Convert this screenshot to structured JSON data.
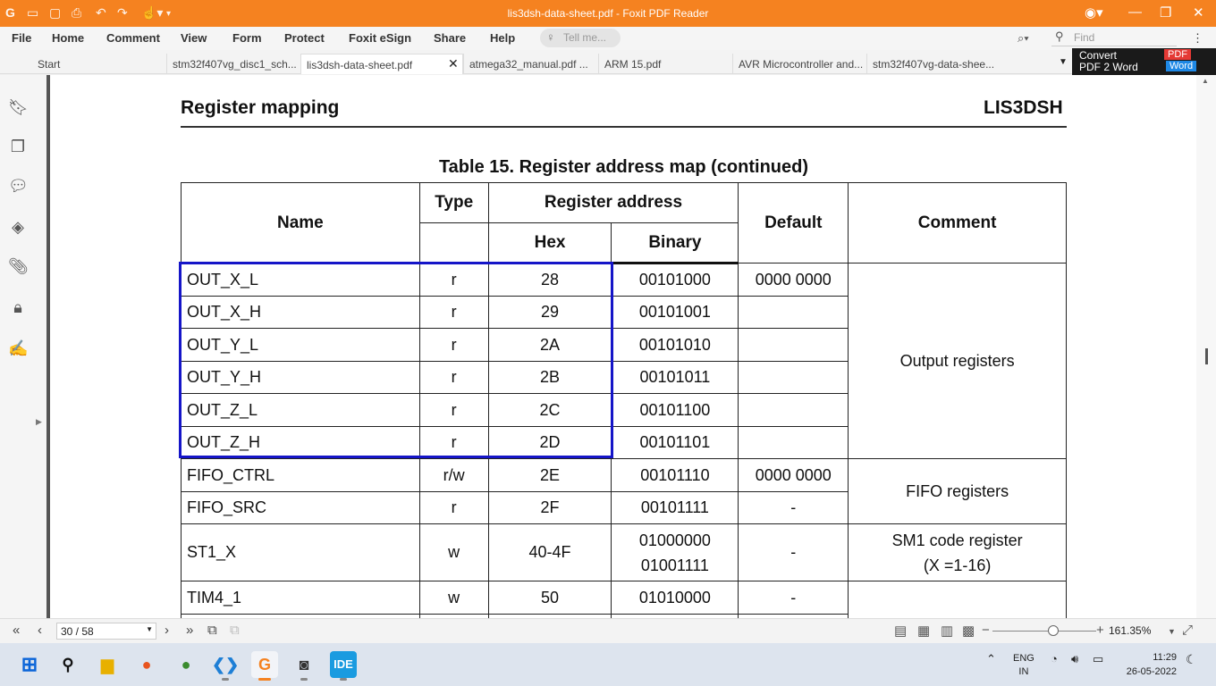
{
  "window": {
    "title": "lis3dsh-data-sheet.pdf - Foxit PDF Reader"
  },
  "menu": {
    "items": [
      "File",
      "Home",
      "Comment",
      "View",
      "Form",
      "Protect",
      "Foxit eSign",
      "Share",
      "Help"
    ],
    "tell_me": "Tell me...",
    "find": "Find"
  },
  "tabs": [
    {
      "label": "Start"
    },
    {
      "label": "stm32f407vg_disc1_sch..."
    },
    {
      "label": "lis3dsh-data-sheet.pdf"
    },
    {
      "label": "atmega32_manual.pdf ..."
    },
    {
      "label": "ARM 15.pdf"
    },
    {
      "label": "AVR Microcontroller and..."
    },
    {
      "label": "stm32f407vg-data-shee..."
    }
  ],
  "ad": {
    "line1": "Convert",
    "line2": "PDF 2 Word",
    "badge_pdf": "PDF",
    "badge_word": "Word"
  },
  "document": {
    "section_title": "Register mapping",
    "part_number": "LIS3DSH",
    "table_caption": "Table 15. Register address map  (continued)",
    "headers": {
      "name": "Name",
      "type": "Type",
      "reg_addr": "Register address",
      "hex": "Hex",
      "binary": "Binary",
      "default": "Default",
      "comment": "Comment"
    },
    "rows": [
      {
        "name": "OUT_X_L",
        "type": "r",
        "hex": "28",
        "binary": "00101000",
        "default": "0000 0000"
      },
      {
        "name": "OUT_X_H",
        "type": "r",
        "hex": "29",
        "binary": "00101001",
        "default": ""
      },
      {
        "name": "OUT_Y_L",
        "type": "r",
        "hex": "2A",
        "binary": "00101010",
        "default": ""
      },
      {
        "name": "OUT_Y_H",
        "type": "r",
        "hex": "2B",
        "binary": "00101011",
        "default": ""
      },
      {
        "name": "OUT_Z_L",
        "type": "r",
        "hex": "2C",
        "binary": "00101100",
        "default": ""
      },
      {
        "name": "OUT_Z_H",
        "type": "r",
        "hex": "2D",
        "binary": "00101101",
        "default": ""
      },
      {
        "name": "FIFO_CTRL",
        "type": "r/w",
        "hex": "2E",
        "binary": "00101110",
        "default": "0000 0000"
      },
      {
        "name": "FIFO_SRC",
        "type": "r",
        "hex": "2F",
        "binary": "00101111",
        "default": "-"
      },
      {
        "name": "ST1_X",
        "type": "w",
        "hex": "40-4F",
        "binary_1": "01000000",
        "binary_2": "01001111",
        "default": "-"
      },
      {
        "name": "TIM4_1",
        "type": "w",
        "hex": "50",
        "binary": "01010000",
        "default": "-"
      }
    ],
    "comments": {
      "output": "Output registers",
      "fifo": "FIFO registers",
      "sm1_1": "SM1 code register",
      "sm1_2": "(X =1-16)"
    }
  },
  "status": {
    "page": "30 / 58",
    "zoom": "161.35%"
  },
  "tray": {
    "lang1": "ENG",
    "lang2": "IN",
    "time": "11:29",
    "date": "26-05-2022"
  },
  "taskbar": {
    "ide_label": "IDE"
  },
  "colors": {
    "accent": "#f58220",
    "highlight_box": "#1515c8"
  }
}
